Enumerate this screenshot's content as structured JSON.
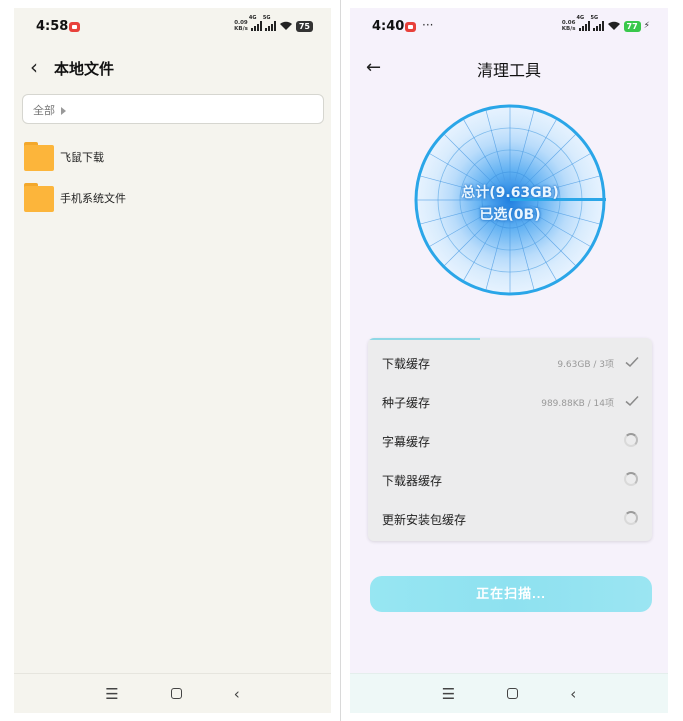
{
  "left_screen": {
    "status": {
      "time": "4:58",
      "speed": "0.09",
      "speed_unit": "KB/s",
      "net": "4G",
      "net2": "5G",
      "battery": "75"
    },
    "header": {
      "title": "本地文件"
    },
    "breadcrumb": {
      "label": "全部"
    },
    "folders": [
      {
        "name": "飞鼠下载",
        "icon": "folder-icon"
      },
      {
        "name": "手机系统文件",
        "icon": "folder-icon"
      }
    ],
    "nav": {
      "menu": "☰",
      "back": "‹"
    }
  },
  "right_screen": {
    "status": {
      "time": "4:40",
      "dots": "···",
      "speed": "0.06",
      "speed_unit": "KB/s",
      "net": "4G",
      "net2": "5G",
      "battery": "77"
    },
    "header": {
      "title": "清理工具"
    },
    "gauge": {
      "total": "总计(9.63GB)",
      "selected": "已选(0B)"
    },
    "items": [
      {
        "label": "下载缓存",
        "meta": "9.63GB / 3项",
        "state": "done"
      },
      {
        "label": "种子缓存",
        "meta": "989.88KB / 14项",
        "state": "done"
      },
      {
        "label": "字幕缓存",
        "meta": "",
        "state": "loading"
      },
      {
        "label": "下载器缓存",
        "meta": "",
        "state": "loading"
      },
      {
        "label": "更新安装包缓存",
        "meta": "",
        "state": "loading"
      }
    ],
    "scan_button": "正在扫描...",
    "nav": {
      "menu": "☰",
      "back": "‹"
    }
  },
  "colors": {
    "folder": "#fcb53b",
    "accent": "#8ee1f0",
    "gauge": "#4aa8ee"
  }
}
